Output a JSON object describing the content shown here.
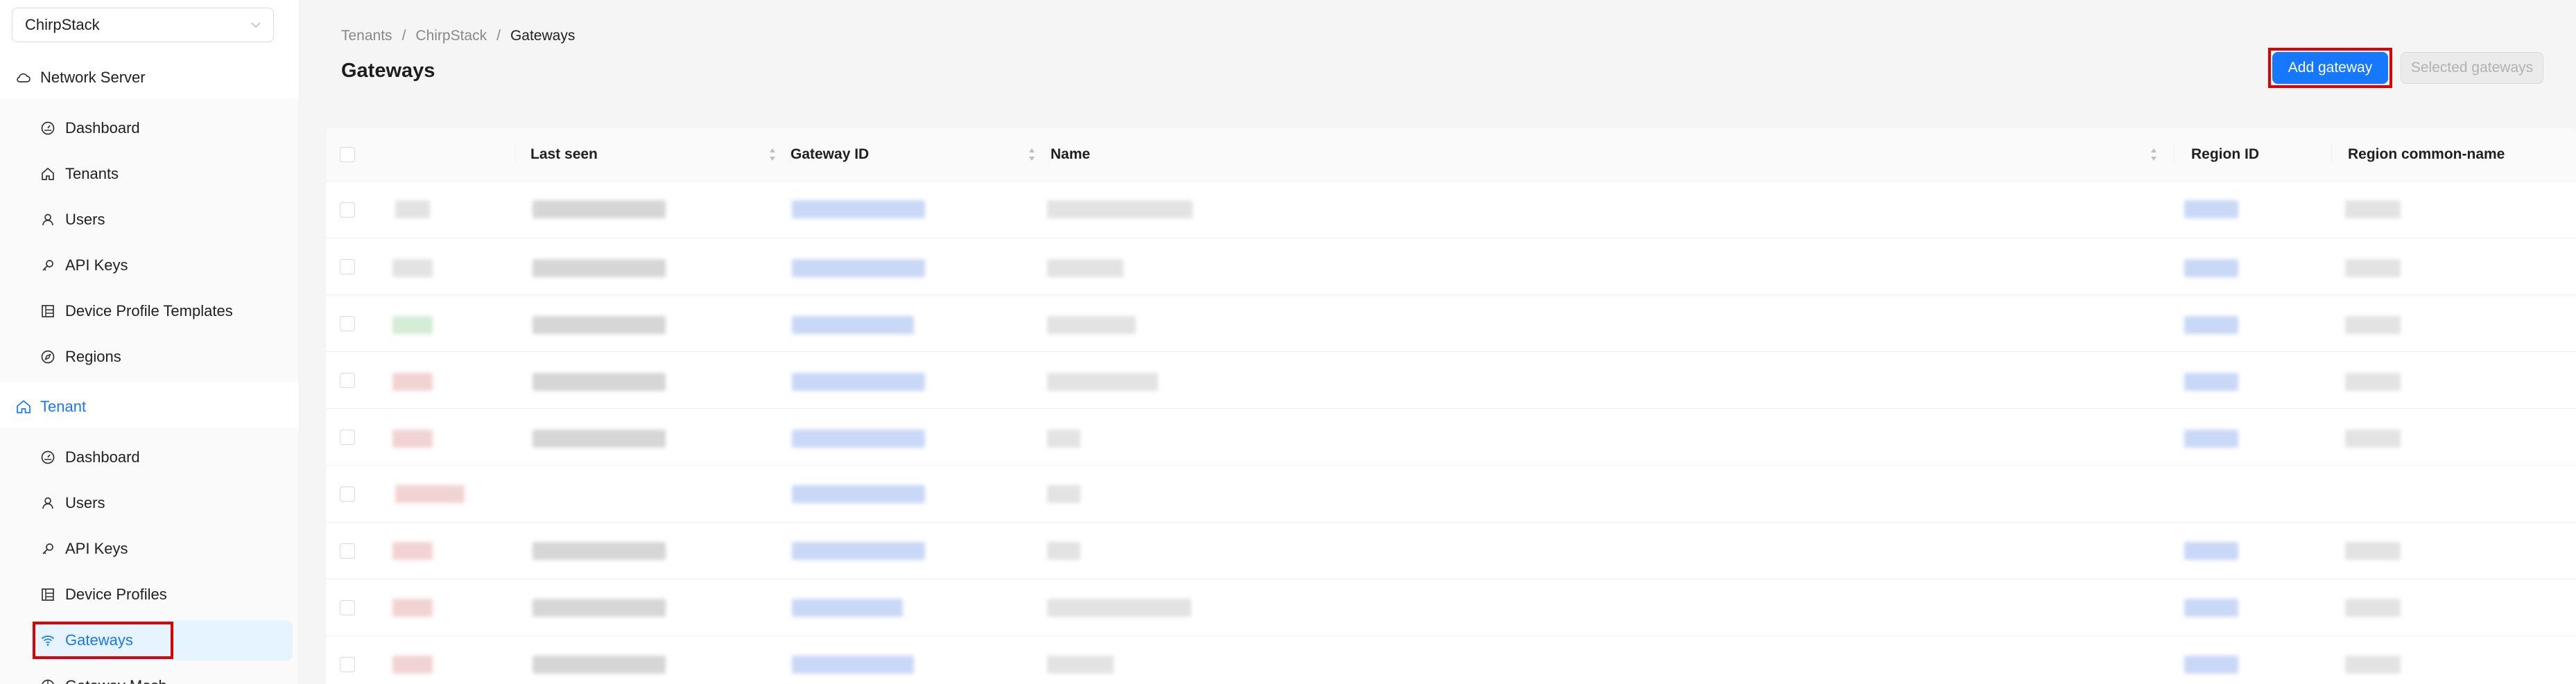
{
  "sidebar": {
    "tenant_select": "ChirpStack",
    "network_server": {
      "label": "Network Server",
      "items": [
        {
          "label": "Dashboard",
          "icon": "dashboard-icon"
        },
        {
          "label": "Tenants",
          "icon": "home-icon"
        },
        {
          "label": "Users",
          "icon": "user-icon"
        },
        {
          "label": "API Keys",
          "icon": "key-icon"
        },
        {
          "label": "Device Profile Templates",
          "icon": "template-icon"
        },
        {
          "label": "Regions",
          "icon": "compass-icon"
        }
      ]
    },
    "tenant": {
      "label": "Tenant",
      "items": [
        {
          "label": "Dashboard",
          "icon": "dashboard-icon"
        },
        {
          "label": "Users",
          "icon": "user-icon"
        },
        {
          "label": "API Keys",
          "icon": "key-icon"
        },
        {
          "label": "Device Profiles",
          "icon": "template-icon"
        },
        {
          "label": "Gateways",
          "icon": "wifi-icon",
          "selected": true
        },
        {
          "label": "Gateway Mesh",
          "icon": "mesh-icon"
        }
      ]
    }
  },
  "breadcrumb": {
    "items": [
      "Tenants",
      "ChirpStack",
      "Gateways"
    ],
    "separator": "/"
  },
  "page": {
    "title": "Gateways",
    "add_button": "Add gateway",
    "selected_button": "Selected gateways"
  },
  "table": {
    "columns": [
      "Last seen",
      "Gateway ID",
      "Name",
      "Region ID",
      "Region common-name"
    ],
    "row_count": 9
  },
  "colors": {
    "primary": "#1677ff",
    "highlight": "#e00000",
    "selected_bg": "#e6f4ff"
  }
}
